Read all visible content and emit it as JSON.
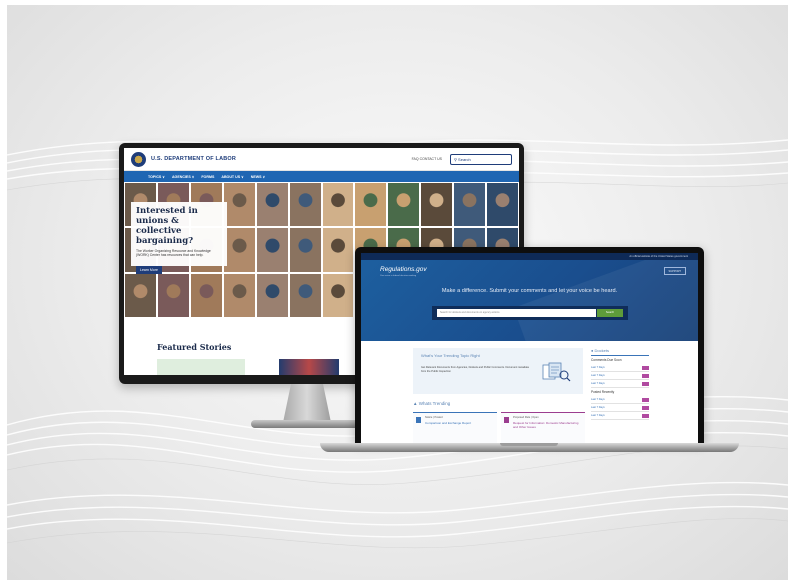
{
  "desktop": {
    "header": {
      "title": "U.S. DEPARTMENT OF LABOR",
      "links": "FAQ  CONTACT US",
      "search_placeholder": "Search"
    },
    "nav": [
      "TOPICS ∨",
      "AGENCIES ∨",
      "FORMS",
      "ABOUT US ∨",
      "NEWS ∨"
    ],
    "hero": {
      "heading": "Interested in unions & collective bargaining?",
      "body": "The Worker Organizing Resource and Knowledge (WORK) Center has resources that can help.",
      "button": "Learn More"
    },
    "featured_heading": "Featured Stories"
  },
  "laptop": {
    "topbar": "An official website of the United States government",
    "logo": "Regulations.gov",
    "logo_sub": "Your voice in federal decision-making",
    "support": "SUPPORT",
    "tagline": "Make a difference. Submit your comments and let your voice be heard.",
    "search_placeholder": "Search for dockets and documents on agency actions",
    "search_button": "Search",
    "trending": {
      "title": "What's Your Trending Topic Right",
      "text": "Get Relevant Documents from Agencies, Dockets and Public Comments. Document metadata from the Public Inspection"
    },
    "activity_heading": "Whats Trending",
    "cards": [
      {
        "type": "Notice  |  Posted",
        "text": "Comparison and Exchange Report"
      },
      {
        "type": "Proposed Rule  |  Open",
        "text": "Request for Information: Domestic Manufacturing and Other Issues"
      }
    ],
    "side": {
      "heading": "Dockets",
      "sub1": "Comments Due Soon",
      "rows1": [
        "Last 7 Days",
        "Last 7 Days",
        "Last 7 Days"
      ],
      "sub2": "Posted Recently",
      "rows2": [
        "Last 7 Days",
        "Last 7 Days",
        "Last 7 Days"
      ]
    }
  }
}
